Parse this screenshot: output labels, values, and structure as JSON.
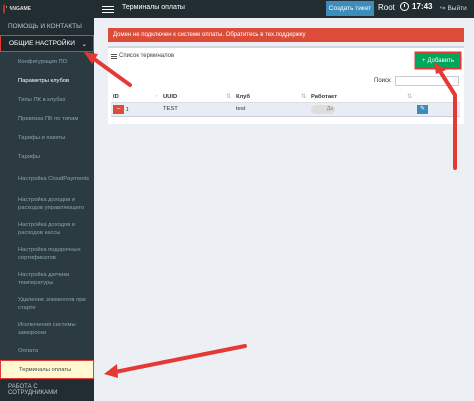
{
  "header": {
    "logo_text": "LANGAME",
    "page_title": "Терминалы оплаты",
    "ticket_button": "Создать тикет",
    "user": "Root",
    "time": "17:43",
    "logout": "Выйти"
  },
  "sidebar": {
    "head": "ПОМОЩЬ И КОНТАКТЫ",
    "section": "ОБЩИЕ НАСТРОЙКИ",
    "items": [
      {
        "label": "Конфигурация ПО"
      },
      {
        "label": "Параметры клубов"
      },
      {
        "label": "Типы ПК в клубах"
      },
      {
        "label": "Привязка ПК по типам"
      },
      {
        "label": "Тарифы и пакеты"
      },
      {
        "label": "Тарифы"
      },
      {
        "label": "Настройка CloudPayments"
      },
      {
        "label": "Настройка доходов и расходов управляющего"
      },
      {
        "label": "Настройка доходов и расходов кассы"
      },
      {
        "label": "Настройка подарочных сертификатов"
      },
      {
        "label": "Настройка датчики температуры"
      },
      {
        "label": "Удаление элементов при старте"
      },
      {
        "label": "Исключения системы замороски"
      },
      {
        "label": "Оплата"
      },
      {
        "label": "Терминалы оплаты"
      }
    ],
    "bottom": "РАБОТА С СОТРУДНИКАМИ"
  },
  "alert": "Домен не подключен к системе оплаты. Обратитесь в тех.поддержку",
  "box": {
    "title": "Список терминалов",
    "add_button": "Добавить",
    "search_label": "Поиск",
    "search_value": ""
  },
  "table": {
    "columns": [
      "ID",
      "UUID",
      "Клуб",
      "Работает"
    ],
    "rows": [
      {
        "id": "1",
        "uuid": "TEST",
        "club": "test",
        "works": "Да"
      }
    ]
  },
  "colors": {
    "alert": "#dd4b39",
    "add": "#00a65a",
    "annotation": "#e53935"
  }
}
